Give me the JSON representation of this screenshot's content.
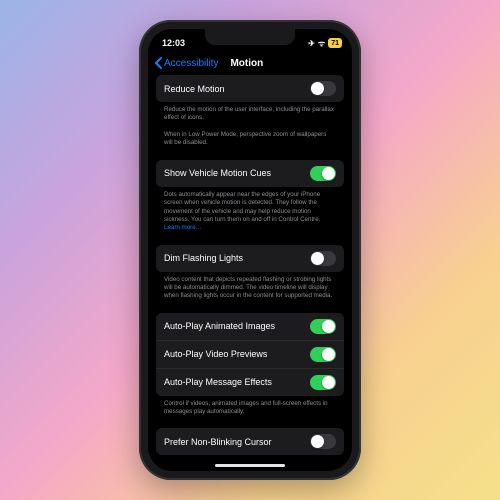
{
  "status": {
    "time": "12:03",
    "airplane": "✈",
    "wifi": "ᯤ",
    "battery": "71"
  },
  "nav": {
    "back_label": "Accessibility",
    "title": "Motion"
  },
  "groups": [
    {
      "rows": [
        {
          "label": "Reduce Motion",
          "on": false
        }
      ],
      "footer": "Reduce the motion of the user interface, including the parallax effect of icons.\n\nWhen in Low Power Mode, perspective zoom of wallpapers will be disabled."
    },
    {
      "rows": [
        {
          "label": "Show Vehicle Motion Cues",
          "on": true
        }
      ],
      "footer": "Dots automatically appear near the edges of your iPhone screen when vehicle motion is detected. They follow the movement of the vehicle and may help reduce motion sickness. You can turn them on and off in Control Centre.",
      "learn_more": "Learn more…"
    },
    {
      "rows": [
        {
          "label": "Dim Flashing Lights",
          "on": false
        }
      ],
      "footer": "Video content that depicts repeated flashing or strobing lights will be automatically dimmed. The video timeline will display when flashing lights occur in the content for supported media."
    },
    {
      "rows": [
        {
          "label": "Auto-Play Animated Images",
          "on": true
        },
        {
          "label": "Auto-Play Video Previews",
          "on": true
        },
        {
          "label": "Auto-Play Message Effects",
          "on": true
        }
      ],
      "footer": "Control if videos, animated images and full-screen effects in messages play automatically."
    },
    {
      "rows": [
        {
          "label": "Prefer Non-Blinking Cursor",
          "on": false
        }
      ],
      "footer": ""
    }
  ]
}
